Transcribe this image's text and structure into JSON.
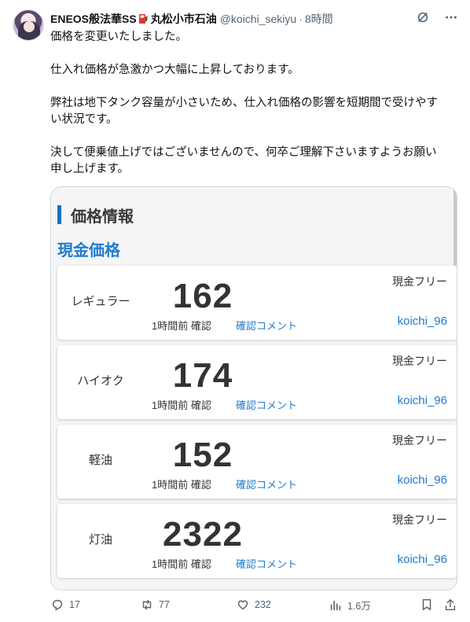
{
  "header": {
    "display_name_part1": "ENEOS般法華SS",
    "display_name_part2": "丸松小市石油",
    "handle": "@koichi_sekiyu",
    "separator": "·",
    "time": "8時間"
  },
  "tweet": {
    "lines": [
      "価格を変更いたしました。",
      "仕入れ価格が急激かつ大幅に上昇しております。",
      "弊社は地下タンク容量が小さいため、仕入れ価格の影響を短期間で受けやす",
      "い状況です。",
      "決して便乗値上げではございませんので、何卒ご理解下さいますようお願い",
      "申し上げます。"
    ]
  },
  "card": {
    "section_title": "価格情報",
    "subsection_title": "現金価格",
    "rows": [
      {
        "fuel": "レギュラー",
        "price": "162",
        "confirmed": "1時間前 確認",
        "comment": "確認コメント",
        "cash_free": "現金フリー",
        "user": "koichi_96"
      },
      {
        "fuel": "ハイオク",
        "price": "174",
        "confirmed": "1時間前 確認",
        "comment": "確認コメント",
        "cash_free": "現金フリー",
        "user": "koichi_96"
      },
      {
        "fuel": "軽油",
        "price": "152",
        "confirmed": "1時間前 確認",
        "comment": "確認コメント",
        "cash_free": "現金フリー",
        "user": "koichi_96"
      },
      {
        "fuel": "灯油",
        "price": "2322",
        "confirmed": "1時間前 確認",
        "comment": "確認コメント",
        "cash_free": "現金フリー",
        "user": "koichi_96"
      }
    ]
  },
  "actions": {
    "replies": "17",
    "retweets": "77",
    "likes": "232",
    "views": "1.6万"
  },
  "colors": {
    "accent_blue": "#1e7bcf",
    "title_bar": "#1a6fbf",
    "muted": "#536471"
  },
  "icons": {
    "grok": "grok-icon",
    "more": "more-icon",
    "reply": "reply-icon",
    "retweet": "retweet-icon",
    "like": "heart-icon",
    "views": "views-icon",
    "bookmark": "bookmark-icon",
    "share": "share-icon"
  }
}
